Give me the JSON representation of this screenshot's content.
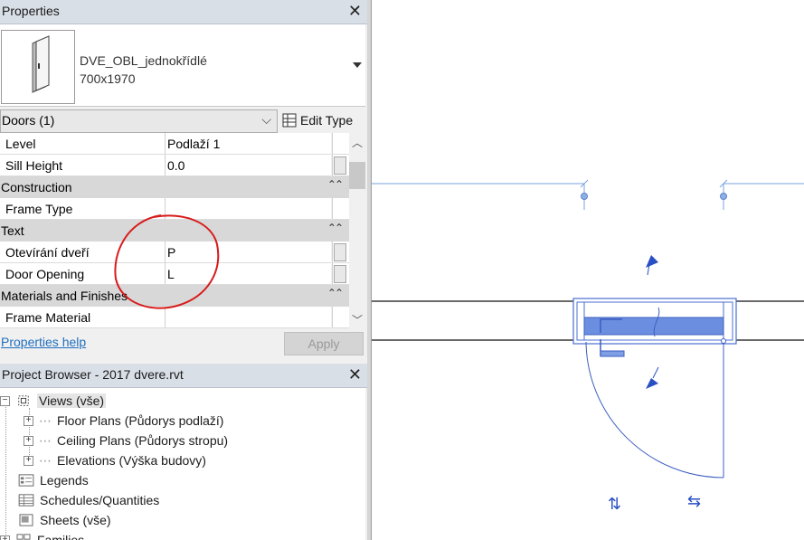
{
  "properties": {
    "title": "Properties",
    "type_name_line1": "DVE_OBL_jednokřídlé",
    "type_name_line2": "700x1970",
    "selector_value": "Doors (1)",
    "edit_type_label": "Edit Type",
    "rows": [
      {
        "kind": "prop",
        "name": "Level",
        "value": "Podlaží 1"
      },
      {
        "kind": "prop",
        "name": "Sill Height",
        "value": "0.0"
      },
      {
        "kind": "cat",
        "name": "Construction"
      },
      {
        "kind": "prop",
        "name": "Frame Type",
        "value": ""
      },
      {
        "kind": "cat",
        "name": "Text"
      },
      {
        "kind": "prop",
        "name": "Otevírání dveří",
        "value": "P"
      },
      {
        "kind": "prop",
        "name": "Door Opening",
        "value": "L"
      },
      {
        "kind": "cat",
        "name": "Materials and Finishes"
      },
      {
        "kind": "prop",
        "name": "Frame Material",
        "value": ""
      }
    ],
    "help_link": "Properties help",
    "apply_label": "Apply"
  },
  "project_browser": {
    "title": "Project Browser - 2017 dvere.rvt",
    "items": [
      {
        "label": "Views (vše)"
      },
      {
        "label": "Floor Plans (Půdorys podlaží)"
      },
      {
        "label": "Ceiling Plans (Půdorys stropu)"
      },
      {
        "label": "Elevations (Výška budovy)"
      },
      {
        "label": "Legends"
      },
      {
        "label": "Schedules/Quantities"
      },
      {
        "label": "Sheets (vše)"
      },
      {
        "label": "Families"
      }
    ]
  },
  "colors": {
    "panel_header": "#d9dfe7",
    "link_blue": "#1f6fbf",
    "drawing_blue": "#1f4fd0",
    "annotation_red": "#d81b1b"
  }
}
